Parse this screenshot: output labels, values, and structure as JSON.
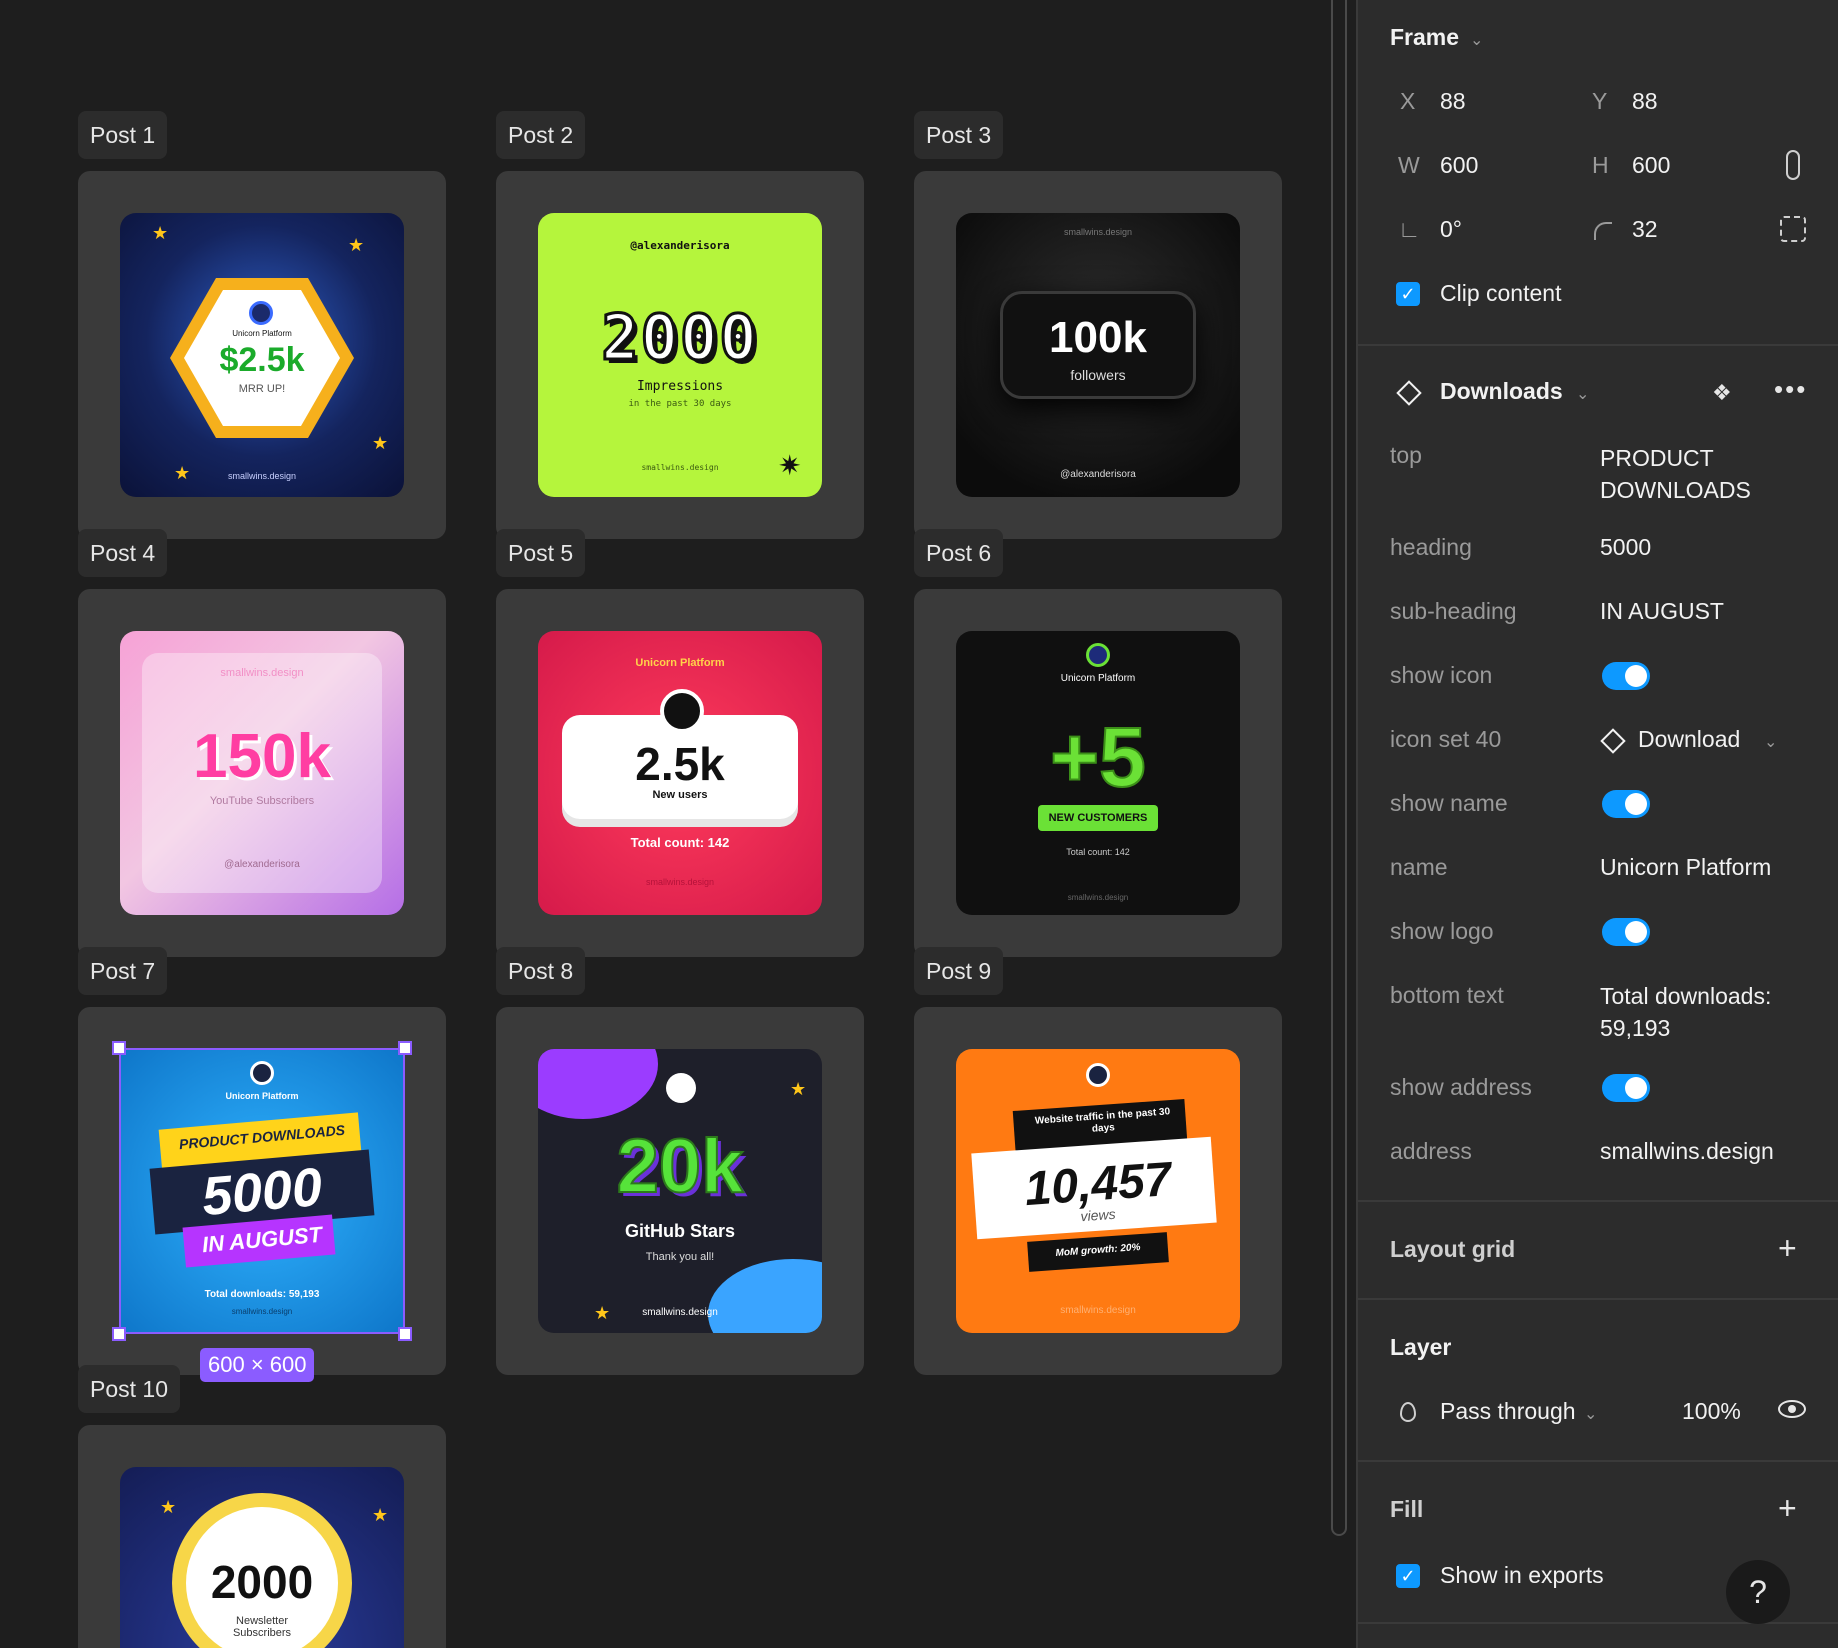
{
  "canvas": {
    "posts": [
      {
        "label": "Post 1",
        "art": {
          "brand": "Unicorn Platform",
          "value": "$2.5k",
          "caption": "MRR UP!",
          "footer": "smallwins.design"
        }
      },
      {
        "label": "Post 2",
        "art": {
          "handle": "@alexanderisora",
          "value": "2000",
          "caption": "Impressions",
          "sub": "in the past 30 days",
          "footer": "smallwins.design"
        }
      },
      {
        "label": "Post 3",
        "art": {
          "header": "smallwins.design",
          "value": "100k",
          "caption": "followers",
          "footer": "@alexanderisora"
        }
      },
      {
        "label": "Post 4",
        "art": {
          "header": "smallwins.design",
          "value": "150k",
          "caption": "YouTube Subscribers",
          "footer": "@alexanderisora"
        }
      },
      {
        "label": "Post 5",
        "art": {
          "brand": "Unicorn Platform",
          "value": "2.5k",
          "caption": "New users",
          "sub": "Total count: 142",
          "footer": "smallwins.design"
        }
      },
      {
        "label": "Post 6",
        "art": {
          "brand": "Unicorn Platform",
          "value": "+5",
          "caption": "NEW CUSTOMERS",
          "sub": "Total count: 142",
          "footer": "smallwins.design"
        }
      },
      {
        "label": "Post 7",
        "art": {
          "brand": "Unicorn Platform",
          "top": "PRODUCT DOWNLOADS",
          "value": "5000",
          "caption": "IN AUGUST",
          "sub": "Total downloads: 59,193",
          "footer": "smallwins.design"
        }
      },
      {
        "label": "Post 8",
        "art": {
          "value": "20k",
          "caption": "GitHub Stars",
          "sub": "Thank you all!",
          "footer": "smallwins.design"
        }
      },
      {
        "label": "Post 9",
        "art": {
          "top": "Website traffic in the past 30 days",
          "value": "10,457",
          "caption": "views",
          "sub": "MoM growth: 20%",
          "footer": "smallwins.design"
        }
      },
      {
        "label": "Post 10",
        "art": {
          "value": "2000",
          "caption": "Newsletter Subscribers"
        }
      }
    ],
    "selection_size": "600 × 600"
  },
  "panel": {
    "frame": {
      "title": "Frame",
      "x_label": "X",
      "x": "88",
      "y_label": "Y",
      "y": "88",
      "w_label": "W",
      "w": "600",
      "h_label": "H",
      "h": "600",
      "rotation": "0°",
      "radius": "32",
      "clip_content": "Clip content"
    },
    "component": {
      "title": "Downloads",
      "props": [
        {
          "name": "top",
          "value": "PRODUCT DOWNLOADS"
        },
        {
          "name": "heading",
          "value": "5000"
        },
        {
          "name": "sub-heading",
          "value": "IN AUGUST"
        },
        {
          "name": "show icon",
          "toggle": true
        },
        {
          "name": "icon set 40",
          "value": "Download"
        },
        {
          "name": "show name",
          "toggle": true
        },
        {
          "name": "name",
          "value": "Unicorn Platform"
        },
        {
          "name": "show logo",
          "toggle": true
        },
        {
          "name": "bottom text",
          "value": "Total downloads: 59,193"
        },
        {
          "name": "show address",
          "toggle": true
        },
        {
          "name": "address",
          "value": "smallwins.design"
        }
      ]
    },
    "layout_grid": {
      "title": "Layout grid"
    },
    "layer": {
      "title": "Layer",
      "blend": "Pass through",
      "opacity": "100%"
    },
    "fill": {
      "title": "Fill",
      "show_in_exports": "Show in exports"
    },
    "help": "?",
    "colors": {
      "accent": "#0d99ff",
      "selection": "#8b5cff",
      "panel_bg": "#2c2c2c",
      "canvas_bg": "#1e1e1e"
    }
  }
}
